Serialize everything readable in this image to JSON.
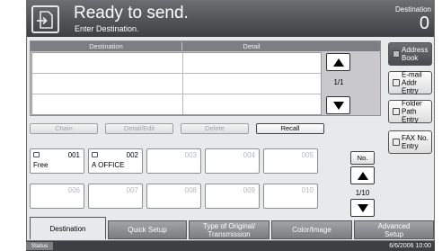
{
  "header": {
    "title": "Ready to send.",
    "subtitle": "Enter Destination.",
    "destination_label": "Destination",
    "destination_count": "0"
  },
  "destination_list": {
    "columns": [
      "Destination",
      "Detail"
    ],
    "rows": [],
    "page_indicator": "1/1"
  },
  "side_buttons": {
    "address_book": "Address Book",
    "email_entry": "E-mail\nAddr Entry",
    "folder_entry": "Folder Path\nEntry",
    "fax_entry": "FAX No.\nEntry"
  },
  "actions": {
    "chain": "Chain",
    "detail_edit": "Detail/Edit",
    "delete": "Delete",
    "recall": "Recall"
  },
  "one_touch_keys": [
    {
      "number": "001",
      "name": "Free",
      "registered": true
    },
    {
      "number": "002",
      "name": "A OFFICE",
      "registered": true
    },
    {
      "number": "003",
      "name": "",
      "registered": false
    },
    {
      "number": "004",
      "name": "",
      "registered": false
    },
    {
      "number": "005",
      "name": "",
      "registered": false
    },
    {
      "number": "006",
      "name": "",
      "registered": false
    },
    {
      "number": "007",
      "name": "",
      "registered": false
    },
    {
      "number": "008",
      "name": "",
      "registered": false
    },
    {
      "number": "009",
      "name": "",
      "registered": false
    },
    {
      "number": "010",
      "name": "",
      "registered": false
    }
  ],
  "keys_nav": {
    "no_label": "No.",
    "page_indicator": "1/10"
  },
  "tabs": [
    {
      "label": "Destination",
      "active": true
    },
    {
      "label": "Quick Setup",
      "active": false
    },
    {
      "label": "Type of Original/\nTransmission",
      "active": false
    },
    {
      "label": "Color/Image",
      "active": false
    },
    {
      "label": "Advanced\nSetup",
      "active": false
    }
  ],
  "status_bar": {
    "label": "Status",
    "datetime": "6/6/2006 10:00"
  }
}
